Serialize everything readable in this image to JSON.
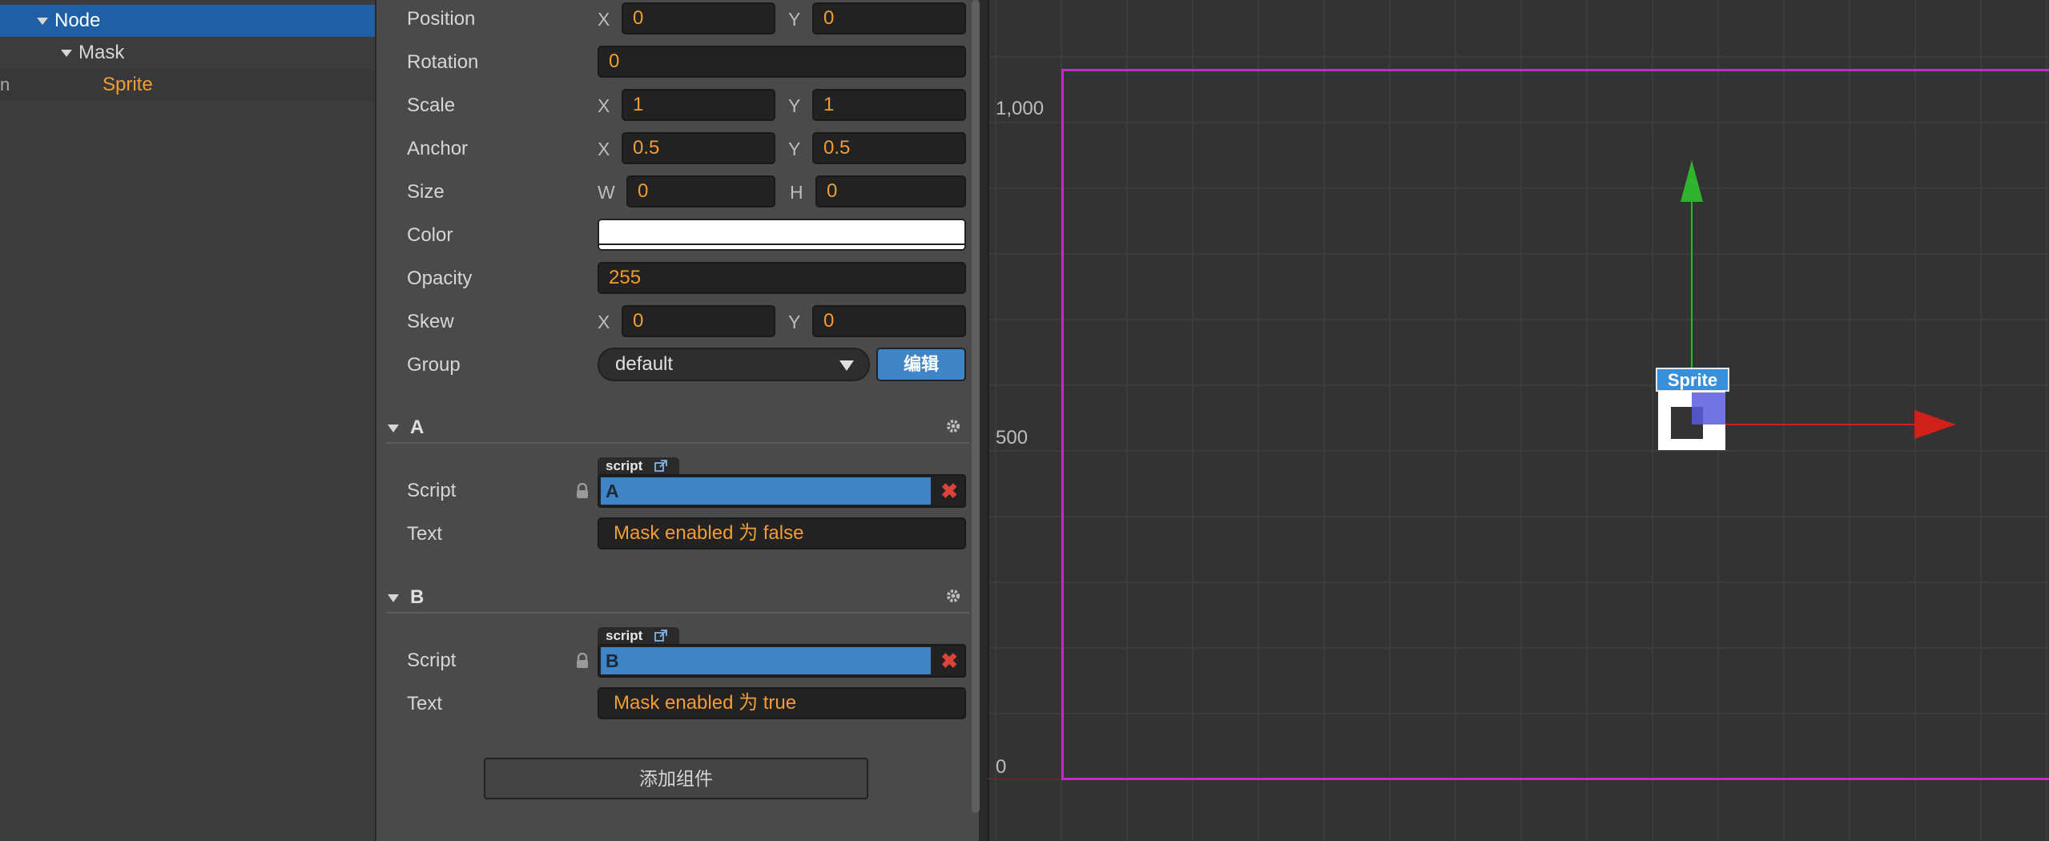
{
  "hierarchy": {
    "items": [
      {
        "label": "Node"
      },
      {
        "label": "Mask"
      },
      {
        "label": "Sprite"
      }
    ],
    "left_glyph": "n"
  },
  "inspector": {
    "position": {
      "label": "Position",
      "x_axis": "X",
      "x": "0",
      "y_axis": "Y",
      "y": "0"
    },
    "rotation": {
      "label": "Rotation",
      "value": "0"
    },
    "scale": {
      "label": "Scale",
      "x_axis": "X",
      "x": "1",
      "y_axis": "Y",
      "y": "1"
    },
    "anchor": {
      "label": "Anchor",
      "x_axis": "X",
      "x": "0.5",
      "y_axis": "Y",
      "y": "0.5"
    },
    "size": {
      "label": "Size",
      "w_axis": "W",
      "w": "0",
      "h_axis": "H",
      "h": "0"
    },
    "color": {
      "label": "Color",
      "value_hex": "#ffffff"
    },
    "opacity": {
      "label": "Opacity",
      "value": "255"
    },
    "skew": {
      "label": "Skew",
      "x_axis": "X",
      "x": "0",
      "y_axis": "Y",
      "y": "0"
    },
    "group": {
      "label": "Group",
      "value": "default",
      "edit_label": "编辑"
    },
    "components": [
      {
        "title": "A",
        "script_tag": "script",
        "script_label": "Script",
        "script_value": "A",
        "text_label": "Text",
        "text_value": "Mask enabled 为 false"
      },
      {
        "title": "B",
        "script_tag": "script",
        "script_label": "Script",
        "script_value": "B",
        "text_label": "Text",
        "text_value": "Mask enabled 为 true"
      }
    ],
    "add_component_label": "添加组件"
  },
  "scene": {
    "y_labels": [
      "1,000",
      "500",
      "0"
    ],
    "node_label": "Sprite",
    "canvas_color": "#c02bc0",
    "x_axis_color": "#d0201a",
    "y_axis_color": "#2fb42f"
  },
  "colors": {
    "selected": "#1f5fa6",
    "accent_value": "#f39c33",
    "button_blue": "#3f85c6"
  }
}
